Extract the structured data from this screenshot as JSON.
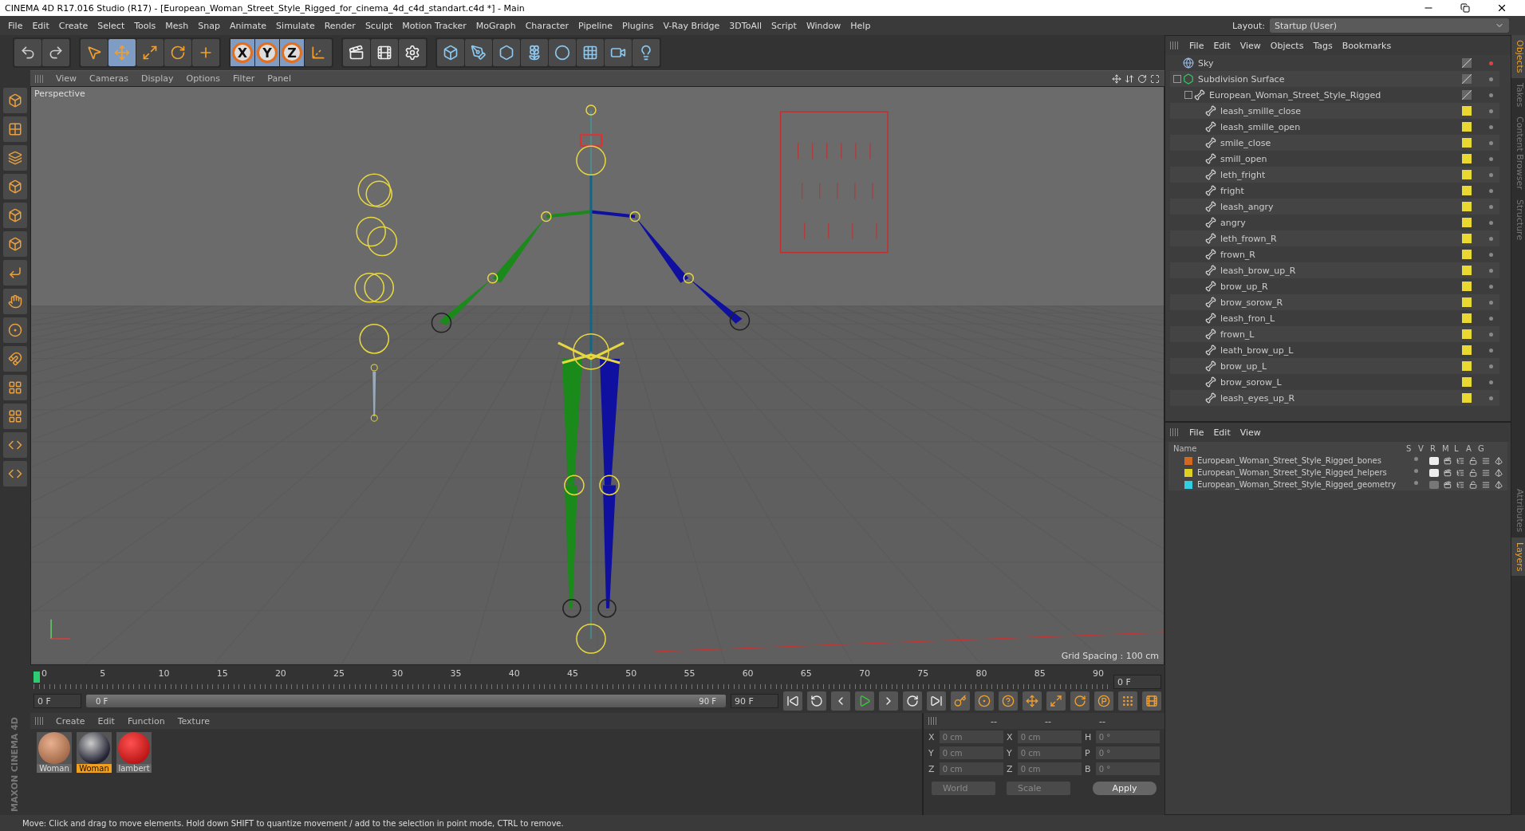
{
  "window": {
    "title": "CINEMA 4D R17.016 Studio (R17) - [European_Woman_Street_Style_Rigged_for_cinema_4d_c4d_standart.c4d *] - Main"
  },
  "menu": [
    "File",
    "Edit",
    "Create",
    "Select",
    "Tools",
    "Mesh",
    "Snap",
    "Animate",
    "Simulate",
    "Render",
    "Sculpt",
    "Motion Tracker",
    "MoGraph",
    "Character",
    "Pipeline",
    "Plugins",
    "V-Ray Bridge",
    "3DToAll",
    "Script",
    "Window",
    "Help"
  ],
  "layout": {
    "label": "Layout:",
    "value": "Startup (User)"
  },
  "toolbar": [
    {
      "kind": "undo",
      "selected": false
    },
    {
      "kind": "redo",
      "selected": false
    },
    {
      "kind": "select",
      "selected": false
    },
    {
      "kind": "move",
      "selected": true
    },
    {
      "kind": "scale",
      "selected": false
    },
    {
      "kind": "rotate",
      "selected": false
    },
    {
      "kind": "add",
      "selected": false
    }
  ],
  "axes": [
    {
      "label": "X",
      "selected": true
    },
    {
      "label": "Y",
      "selected": true
    },
    {
      "label": "Z",
      "selected": true
    }
  ],
  "toolbar_2": [
    {
      "kind": "coords"
    },
    {
      "kind": "render-view"
    },
    {
      "kind": "render"
    },
    {
      "kind": "render-settings"
    },
    {
      "kind": "cube"
    },
    {
      "kind": "pen"
    },
    {
      "kind": "subdivision"
    },
    {
      "kind": "cloner"
    },
    {
      "kind": "deformer"
    },
    {
      "kind": "floor"
    },
    {
      "kind": "camera"
    },
    {
      "kind": "light"
    }
  ],
  "left_tools": [
    {
      "kind": "cube"
    },
    {
      "kind": "checker"
    },
    {
      "kind": "layers"
    },
    {
      "kind": "cube"
    },
    {
      "kind": "cube"
    },
    {
      "kind": "cube"
    },
    {
      "kind": "angle"
    },
    {
      "kind": "hand"
    },
    {
      "kind": "sphere"
    },
    {
      "kind": "magnet"
    },
    {
      "kind": "grid"
    },
    {
      "kind": "grid"
    },
    {
      "kind": "python"
    },
    {
      "kind": "python"
    }
  ],
  "viewport": {
    "menu": [
      "View",
      "Cameras",
      "Display",
      "Options",
      "Filter",
      "Panel"
    ],
    "camera": "Perspective",
    "grid_spacing": "Grid Spacing : 100 cm"
  },
  "timeline": {
    "ticks": [
      "0",
      "5",
      "10",
      "15",
      "20",
      "25",
      "30",
      "35",
      "40",
      "45",
      "50",
      "55",
      "60",
      "65",
      "70",
      "75",
      "80",
      "85",
      "90"
    ],
    "current": "0 F",
    "start": "0 F",
    "range": {
      "start": "0 F",
      "end": "90 F",
      "level": 1
    },
    "end": "90 F"
  },
  "playback": [
    {
      "kind": "first"
    },
    {
      "kind": "prev-key"
    },
    {
      "kind": "prev"
    },
    {
      "kind": "play"
    },
    {
      "kind": "next"
    },
    {
      "kind": "next-key"
    },
    {
      "kind": "last"
    }
  ],
  "keys": [
    {
      "kind": "key"
    },
    {
      "kind": "record"
    },
    {
      "kind": "help"
    },
    {
      "kind": "move"
    },
    {
      "kind": "scale"
    },
    {
      "kind": "rotate"
    },
    {
      "kind": "param"
    },
    {
      "kind": "points"
    },
    {
      "kind": "film"
    }
  ],
  "materials": {
    "menu": [
      "Create",
      "Edit",
      "Function",
      "Texture"
    ],
    "items": [
      {
        "name": "Woman",
        "kind": "skin",
        "selected": false
      },
      {
        "name": "Woman",
        "kind": "mixed",
        "selected": true
      },
      {
        "name": "lambert",
        "kind": "red",
        "selected": false
      }
    ]
  },
  "coordinates": {
    "headers": [
      "--",
      "--",
      "--"
    ],
    "rows": [
      {
        "axis": "X",
        "pos": "0 cm",
        "axis2": "X",
        "size": "0 cm",
        "axis3": "H",
        "rot": "0 °"
      },
      {
        "axis": "Y",
        "pos": "0 cm",
        "axis2": "Y",
        "size": "0 cm",
        "axis3": "P",
        "rot": "0 °"
      },
      {
        "axis": "Z",
        "pos": "0 cm",
        "axis2": "Z",
        "size": "0 cm",
        "axis3": "B",
        "rot": "0 °"
      }
    ],
    "space": "World",
    "mode": "Scale",
    "apply": "Apply"
  },
  "objects": {
    "menu": [
      "File",
      "Edit",
      "View",
      "Objects",
      "Tags",
      "Bookmarks"
    ],
    "tree": [
      {
        "name": "Sky",
        "kind": "sky"
      },
      {
        "name": "Subdivision Surface",
        "kind": "subdivision",
        "expanded": true,
        "children": [
          {
            "name": "European_Woman_Street_Style_Rigged",
            "kind": "null",
            "expanded": true,
            "children": [
              {
                "name": "leash_smille_close",
                "kind": "joint"
              },
              {
                "name": "leash_smille_open",
                "kind": "joint"
              },
              {
                "name": "smile_close",
                "kind": "joint"
              },
              {
                "name": "smill_open",
                "kind": "joint"
              },
              {
                "name": "leth_fright",
                "kind": "joint"
              },
              {
                "name": "fright",
                "kind": "joint"
              },
              {
                "name": "leash_angry",
                "kind": "joint"
              },
              {
                "name": "angry",
                "kind": "joint"
              },
              {
                "name": "leth_frown_R",
                "kind": "joint"
              },
              {
                "name": "frown_R",
                "kind": "joint"
              },
              {
                "name": "leash_brow_up_R",
                "kind": "joint"
              },
              {
                "name": "brow_up_R",
                "kind": "joint"
              },
              {
                "name": "brow_sorow_R",
                "kind": "joint"
              },
              {
                "name": "leash_fron_L",
                "kind": "joint"
              },
              {
                "name": "frown_L",
                "kind": "joint"
              },
              {
                "name": "leath_brow_up_L",
                "kind": "joint"
              },
              {
                "name": "brow_up_L",
                "kind": "joint"
              },
              {
                "name": "brow_sorow_L",
                "kind": "joint"
              },
              {
                "name": "leash_eyes_up_R",
                "kind": "joint"
              }
            ]
          }
        ]
      }
    ]
  },
  "layers": {
    "menu": [
      "File",
      "Edit",
      "View"
    ],
    "columns": [
      "Name",
      "S",
      "V",
      "R",
      "M",
      "L",
      "A",
      "G"
    ],
    "rows": [
      {
        "name": "European_Woman_Street_Style_Rigged_bones",
        "color": "#d2691e",
        "visible": true
      },
      {
        "name": "European_Woman_Street_Style_Rigged_helpers",
        "color": "#e0d020",
        "visible": true
      },
      {
        "name": "European_Woman_Street_Style_Rigged_geometry",
        "color": "#30d0e0",
        "visible": false
      }
    ]
  },
  "side_tabs": [
    {
      "label": "Objects",
      "selected": true
    },
    {
      "label": "Takes",
      "selected": false
    },
    {
      "label": "Content Browser",
      "selected": false
    },
    {
      "label": "Structure",
      "selected": false
    }
  ],
  "side_tabs_2": [
    {
      "label": "Attributes",
      "selected": false
    },
    {
      "label": "Layers",
      "selected": true
    }
  ],
  "brand": "MAXON CINEMA 4D",
  "status": "Move: Click and drag to move elements. Hold down SHIFT to quantize movement / add to the selection in point mode, CTRL to remove."
}
